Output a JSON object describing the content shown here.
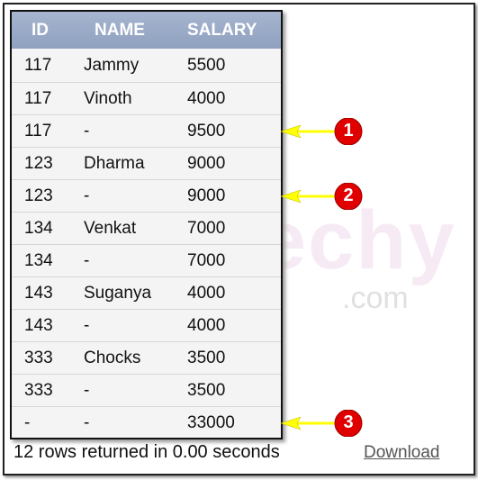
{
  "table": {
    "headers": [
      "ID",
      "NAME",
      "SALARY"
    ],
    "rows": [
      [
        "117",
        "Jammy",
        "5500"
      ],
      [
        "117",
        "Vinoth",
        "4000"
      ],
      [
        "117",
        "-",
        "9500"
      ],
      [
        "123",
        "Dharma",
        "9000"
      ],
      [
        "123",
        "-",
        "9000"
      ],
      [
        "134",
        "Venkat",
        "7000"
      ],
      [
        "134",
        "-",
        "7000"
      ],
      [
        "143",
        "Suganya",
        "4000"
      ],
      [
        "143",
        "-",
        "4000"
      ],
      [
        "333",
        "Chocks",
        "3500"
      ],
      [
        "333",
        "-",
        "3500"
      ],
      [
        "-",
        "-",
        "33000"
      ]
    ]
  },
  "footer": {
    "status": "12 rows returned in 0.00 seconds",
    "download_label": "Download"
  },
  "watermark": {
    "text": "Wikitechy",
    "suffix": ".com"
  },
  "callouts": [
    {
      "label": "1",
      "row": 3
    },
    {
      "label": "2",
      "row": 5
    },
    {
      "label": "3",
      "row": 12
    }
  ],
  "colors": {
    "header": "#98a9c6",
    "arrow": "#ffff00",
    "badge": "#e00000"
  }
}
